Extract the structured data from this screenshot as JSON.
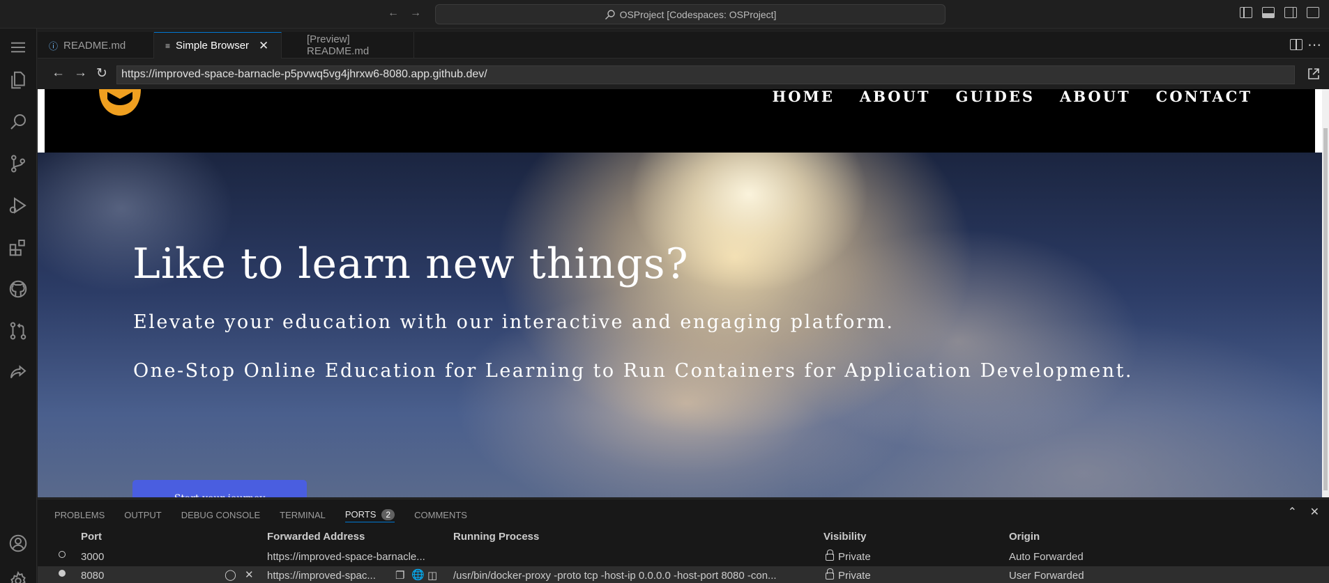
{
  "window": {
    "command_center": "OSProject [Codespaces: OSProject]"
  },
  "tabs": [
    {
      "label": "README.md",
      "icon": "info-icon",
      "active": false
    },
    {
      "label": "Simple Browser",
      "icon": "preview-icon",
      "active": true
    },
    {
      "label": "[Preview] README.md",
      "icon": "",
      "active": false
    }
  ],
  "browser": {
    "url": "https://improved-space-barnacle-p5pvwq5vg4jhrxw6-8080.app.github.dev/"
  },
  "site": {
    "nav": [
      "HOME",
      "ABOUT",
      "GUIDES",
      "ABOUT",
      "CONTACT"
    ],
    "hero_title": "Like to learn new things?",
    "hero_sub1": "Elevate your education with our interactive and engaging platform.",
    "hero_sub2": "One-Stop Online Education for Learning to Run Containers for Application Development.",
    "cta": "Start your journey",
    "colors": {
      "header_bg": "#000000",
      "cta_bg": "#4a5ee0",
      "logo": "#f0a020"
    }
  },
  "panel": {
    "tabs": [
      "PROBLEMS",
      "OUTPUT",
      "DEBUG CONSOLE",
      "TERMINAL",
      "PORTS",
      "COMMENTS"
    ],
    "active_tab": "PORTS",
    "ports_badge": "2",
    "columns": [
      "Port",
      "Forwarded Address",
      "Running Process",
      "Visibility",
      "Origin"
    ],
    "rows": [
      {
        "port": "3000",
        "address": "https://improved-space-barnacle...",
        "process": "",
        "visibility": "Private",
        "origin": "Auto Forwarded"
      },
      {
        "port": "8080",
        "address": "https://improved-spac...",
        "process": "/usr/bin/docker-proxy -proto tcp -host-ip 0.0.0.0 -host-port 8080 -con...",
        "visibility": "Private",
        "origin": "User Forwarded"
      }
    ]
  }
}
